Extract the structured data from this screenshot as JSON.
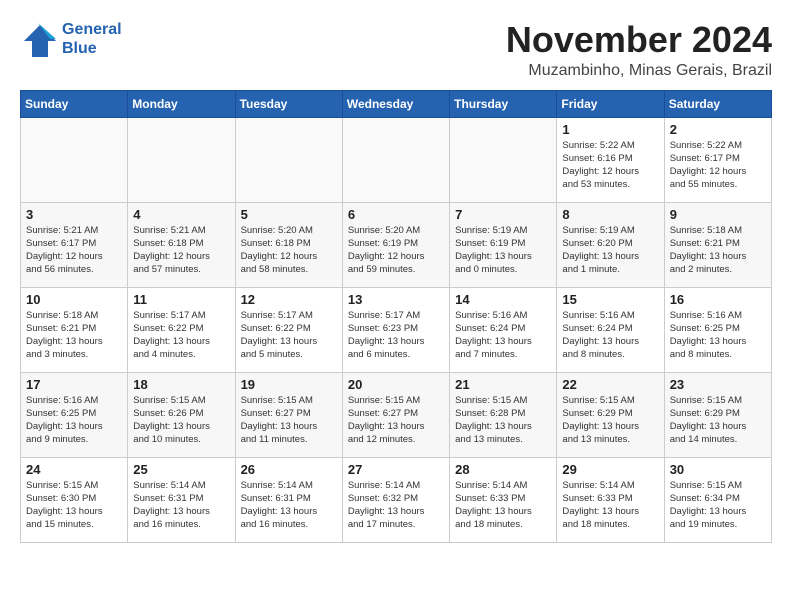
{
  "logo": {
    "line1": "General",
    "line2": "Blue"
  },
  "title": "November 2024",
  "location": "Muzambinho, Minas Gerais, Brazil",
  "headers": [
    "Sunday",
    "Monday",
    "Tuesday",
    "Wednesday",
    "Thursday",
    "Friday",
    "Saturday"
  ],
  "weeks": [
    [
      {
        "day": "",
        "info": "",
        "empty": true
      },
      {
        "day": "",
        "info": "",
        "empty": true
      },
      {
        "day": "",
        "info": "",
        "empty": true
      },
      {
        "day": "",
        "info": "",
        "empty": true
      },
      {
        "day": "",
        "info": "",
        "empty": true
      },
      {
        "day": "1",
        "info": "Sunrise: 5:22 AM\nSunset: 6:16 PM\nDaylight: 12 hours\nand 53 minutes.",
        "empty": false
      },
      {
        "day": "2",
        "info": "Sunrise: 5:22 AM\nSunset: 6:17 PM\nDaylight: 12 hours\nand 55 minutes.",
        "empty": false
      }
    ],
    [
      {
        "day": "3",
        "info": "Sunrise: 5:21 AM\nSunset: 6:17 PM\nDaylight: 12 hours\nand 56 minutes.",
        "empty": false
      },
      {
        "day": "4",
        "info": "Sunrise: 5:21 AM\nSunset: 6:18 PM\nDaylight: 12 hours\nand 57 minutes.",
        "empty": false
      },
      {
        "day": "5",
        "info": "Sunrise: 5:20 AM\nSunset: 6:18 PM\nDaylight: 12 hours\nand 58 minutes.",
        "empty": false
      },
      {
        "day": "6",
        "info": "Sunrise: 5:20 AM\nSunset: 6:19 PM\nDaylight: 12 hours\nand 59 minutes.",
        "empty": false
      },
      {
        "day": "7",
        "info": "Sunrise: 5:19 AM\nSunset: 6:19 PM\nDaylight: 13 hours\nand 0 minutes.",
        "empty": false
      },
      {
        "day": "8",
        "info": "Sunrise: 5:19 AM\nSunset: 6:20 PM\nDaylight: 13 hours\nand 1 minute.",
        "empty": false
      },
      {
        "day": "9",
        "info": "Sunrise: 5:18 AM\nSunset: 6:21 PM\nDaylight: 13 hours\nand 2 minutes.",
        "empty": false
      }
    ],
    [
      {
        "day": "10",
        "info": "Sunrise: 5:18 AM\nSunset: 6:21 PM\nDaylight: 13 hours\nand 3 minutes.",
        "empty": false
      },
      {
        "day": "11",
        "info": "Sunrise: 5:17 AM\nSunset: 6:22 PM\nDaylight: 13 hours\nand 4 minutes.",
        "empty": false
      },
      {
        "day": "12",
        "info": "Sunrise: 5:17 AM\nSunset: 6:22 PM\nDaylight: 13 hours\nand 5 minutes.",
        "empty": false
      },
      {
        "day": "13",
        "info": "Sunrise: 5:17 AM\nSunset: 6:23 PM\nDaylight: 13 hours\nand 6 minutes.",
        "empty": false
      },
      {
        "day": "14",
        "info": "Sunrise: 5:16 AM\nSunset: 6:24 PM\nDaylight: 13 hours\nand 7 minutes.",
        "empty": false
      },
      {
        "day": "15",
        "info": "Sunrise: 5:16 AM\nSunset: 6:24 PM\nDaylight: 13 hours\nand 8 minutes.",
        "empty": false
      },
      {
        "day": "16",
        "info": "Sunrise: 5:16 AM\nSunset: 6:25 PM\nDaylight: 13 hours\nand 8 minutes.",
        "empty": false
      }
    ],
    [
      {
        "day": "17",
        "info": "Sunrise: 5:16 AM\nSunset: 6:25 PM\nDaylight: 13 hours\nand 9 minutes.",
        "empty": false
      },
      {
        "day": "18",
        "info": "Sunrise: 5:15 AM\nSunset: 6:26 PM\nDaylight: 13 hours\nand 10 minutes.",
        "empty": false
      },
      {
        "day": "19",
        "info": "Sunrise: 5:15 AM\nSunset: 6:27 PM\nDaylight: 13 hours\nand 11 minutes.",
        "empty": false
      },
      {
        "day": "20",
        "info": "Sunrise: 5:15 AM\nSunset: 6:27 PM\nDaylight: 13 hours\nand 12 minutes.",
        "empty": false
      },
      {
        "day": "21",
        "info": "Sunrise: 5:15 AM\nSunset: 6:28 PM\nDaylight: 13 hours\nand 13 minutes.",
        "empty": false
      },
      {
        "day": "22",
        "info": "Sunrise: 5:15 AM\nSunset: 6:29 PM\nDaylight: 13 hours\nand 13 minutes.",
        "empty": false
      },
      {
        "day": "23",
        "info": "Sunrise: 5:15 AM\nSunset: 6:29 PM\nDaylight: 13 hours\nand 14 minutes.",
        "empty": false
      }
    ],
    [
      {
        "day": "24",
        "info": "Sunrise: 5:15 AM\nSunset: 6:30 PM\nDaylight: 13 hours\nand 15 minutes.",
        "empty": false
      },
      {
        "day": "25",
        "info": "Sunrise: 5:14 AM\nSunset: 6:31 PM\nDaylight: 13 hours\nand 16 minutes.",
        "empty": false
      },
      {
        "day": "26",
        "info": "Sunrise: 5:14 AM\nSunset: 6:31 PM\nDaylight: 13 hours\nand 16 minutes.",
        "empty": false
      },
      {
        "day": "27",
        "info": "Sunrise: 5:14 AM\nSunset: 6:32 PM\nDaylight: 13 hours\nand 17 minutes.",
        "empty": false
      },
      {
        "day": "28",
        "info": "Sunrise: 5:14 AM\nSunset: 6:33 PM\nDaylight: 13 hours\nand 18 minutes.",
        "empty": false
      },
      {
        "day": "29",
        "info": "Sunrise: 5:14 AM\nSunset: 6:33 PM\nDaylight: 13 hours\nand 18 minutes.",
        "empty": false
      },
      {
        "day": "30",
        "info": "Sunrise: 5:15 AM\nSunset: 6:34 PM\nDaylight: 13 hours\nand 19 minutes.",
        "empty": false
      }
    ]
  ]
}
